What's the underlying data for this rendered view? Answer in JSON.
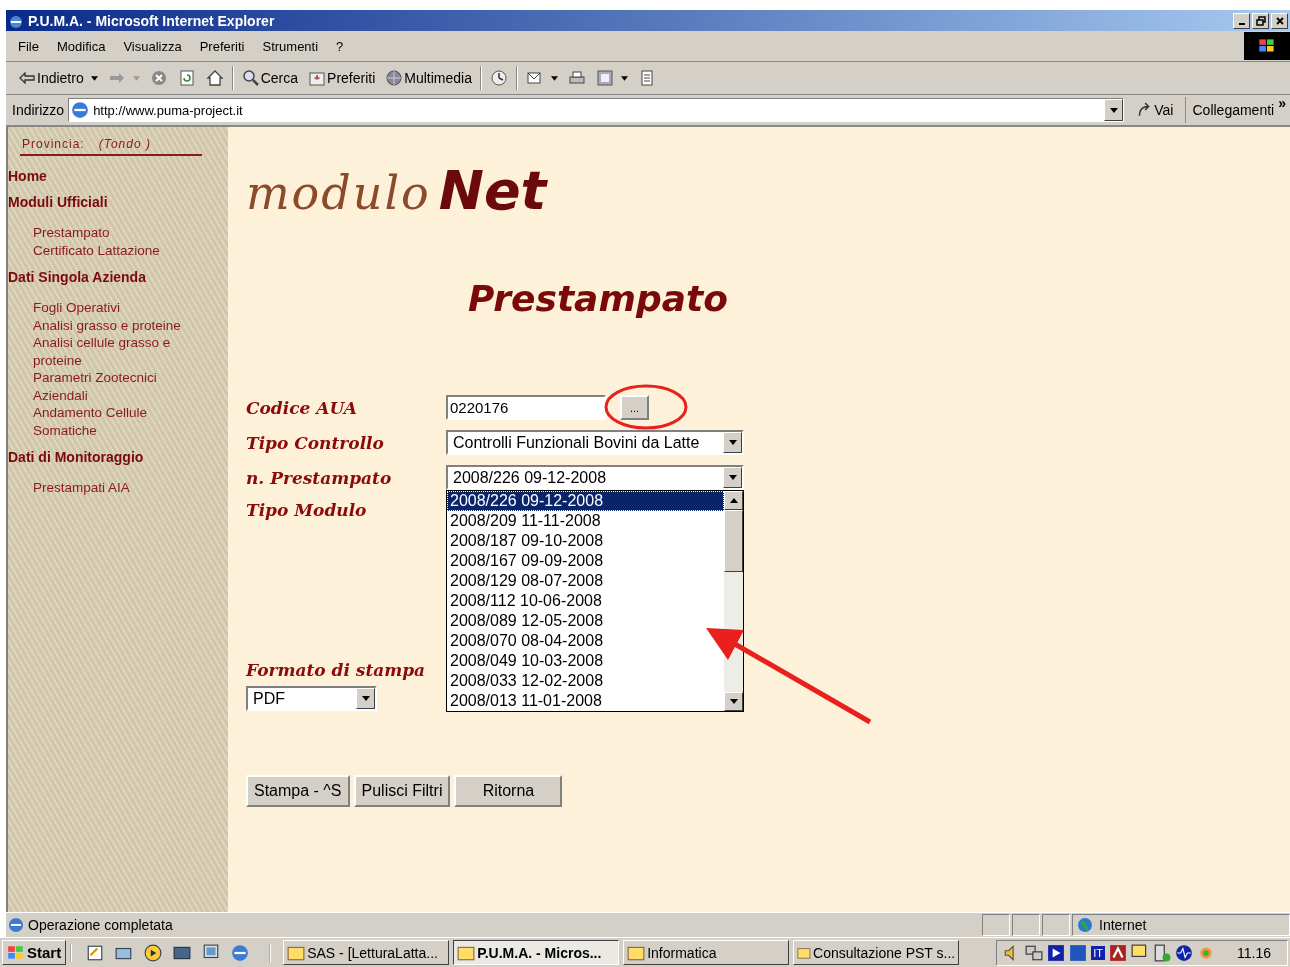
{
  "window": {
    "title": "P.U.M.A. - Microsoft Internet Explorer"
  },
  "menu": [
    "File",
    "Modifica",
    "Visualizza",
    "Preferiti",
    "Strumenti",
    "?"
  ],
  "toolbar": [
    {
      "kind": "back",
      "label": "Indietro"
    },
    {
      "kind": "forward"
    },
    {
      "kind": "stop"
    },
    {
      "kind": "refresh"
    },
    {
      "kind": "home"
    },
    {
      "kind": "search",
      "label": "Cerca"
    },
    {
      "kind": "favorites",
      "label": "Preferiti"
    },
    {
      "kind": "media",
      "label": "Multimedia"
    },
    {
      "kind": "history"
    },
    {
      "kind": "mail"
    },
    {
      "kind": "print"
    },
    {
      "kind": "edit"
    },
    {
      "kind": "discuss"
    }
  ],
  "address": {
    "label": "Indirizzo",
    "url": "http://www.puma-project.it",
    "go": "Vai",
    "links": "Collegamenti",
    "more": "»"
  },
  "sidebar": {
    "province_label": "Provincia:",
    "province_value": "(Tondo )",
    "sections": [
      {
        "title": "Home"
      },
      {
        "title": "Moduli Ufficiali",
        "items": [
          "Prestampato",
          "Certificato Lattazione"
        ]
      },
      {
        "title": "Dati Singola Azienda",
        "items": [
          "Fogli Operativi",
          "Analisi grasso e proteine",
          "Analisi cellule grasso e proteine",
          "Parametri Zootecnici Aziendali",
          "Andamento Cellule Somatiche"
        ]
      },
      {
        "title": "Dati di Monitoraggio",
        "items": [
          "Prestampati AIA"
        ]
      }
    ]
  },
  "logo": {
    "script": "modulo",
    "bold": "Net"
  },
  "page_title": "Prestampato",
  "form": {
    "codice_label": "Codice AUA",
    "codice_value": "0220176",
    "browse": "...",
    "tipo_controllo_label": "Tipo Controllo",
    "tipo_controllo_value": "Controlli Funzionali Bovini da Latte",
    "prestampato_label": "n. Prestampato",
    "prestampato_value": "2008/226 09-12-2008",
    "prestampato_options": [
      {
        "label": "2008/226 09-12-2008",
        "selected": true
      },
      {
        "label": "2008/209 11-11-2008",
        "selected": false
      },
      {
        "label": "2008/187 09-10-2008",
        "selected": false
      },
      {
        "label": "2008/167 09-09-2008",
        "selected": false
      },
      {
        "label": "2008/129 08-07-2008",
        "selected": false
      },
      {
        "label": "2008/112 10-06-2008",
        "selected": false
      },
      {
        "label": "2008/089 12-05-2008",
        "selected": false
      },
      {
        "label": "2008/070 08-04-2008",
        "selected": false
      },
      {
        "label": "2008/049 10-03-2008",
        "selected": false
      },
      {
        "label": "2008/033 12-02-2008",
        "selected": false
      },
      {
        "label": "2008/013 11-01-2008",
        "selected": false
      }
    ],
    "tipo_modulo_label": "Tipo Modulo",
    "formato_label": "Formato di stampa",
    "formato_value": "PDF"
  },
  "buttons": [
    "Stampa - ^S",
    "Pulisci Filtri",
    "Ritorna"
  ],
  "status": {
    "text": "Operazione completata",
    "zone": "Internet"
  },
  "taskbar": {
    "start": "Start",
    "language": "IT",
    "tasks": [
      {
        "label": "SAS - [LetturaLatta...",
        "selected": false
      },
      {
        "label": "P.U.M.A. - Micros...",
        "selected": true
      },
      {
        "label": "Informatica",
        "selected": false
      },
      {
        "label": "Consultazione PST s...",
        "selected": false
      }
    ],
    "clock": "11.16"
  }
}
